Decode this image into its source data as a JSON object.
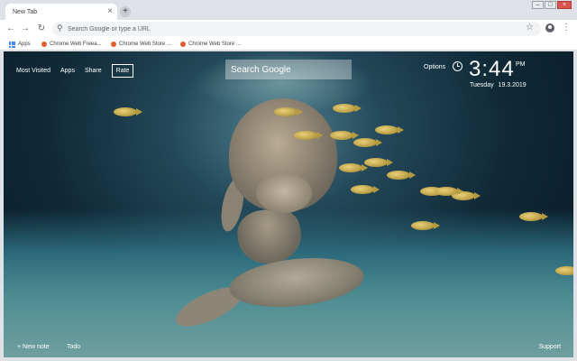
{
  "browser": {
    "tab": {
      "title": "New Tab",
      "close_glyph": "×"
    },
    "new_tab_glyph": "+",
    "window_controls": {
      "minimize": "–",
      "maximize": "□",
      "close": "×"
    },
    "nav": {
      "back": "←",
      "forward": "→",
      "reload": "↻"
    },
    "omnibox": {
      "placeholder": "Search Google or type a URL",
      "icon": "search-icon",
      "star": "☆"
    },
    "menu_glyph": "⋮",
    "bookmarks": [
      {
        "label": "Apps",
        "icon": "apps-grid-icon"
      },
      {
        "label": "Chrome Web Freea...",
        "icon": "favicon"
      },
      {
        "label": "Chrome Web Store ...",
        "icon": "favicon"
      },
      {
        "label": "Chrome Web Store ...",
        "icon": "favicon"
      }
    ]
  },
  "page": {
    "nav_links": [
      "Most Visited",
      "Apps",
      "Share",
      "Rate"
    ],
    "search_placeholder": "Search Google",
    "options_label": "Options",
    "clock": {
      "time": "3:44",
      "ampm": "PM",
      "day": "Tuesday",
      "date": "19.3.2019"
    },
    "bottom": {
      "new_note": "+ New note",
      "todo": "Todo",
      "support": "Support"
    }
  },
  "colors": {
    "chrome_bg": "#dee1e6",
    "toolbar_bg": "#ffffff",
    "water_deep": "#061522",
    "water_mid": "#24495a",
    "text_on_image": "#ffffff"
  }
}
